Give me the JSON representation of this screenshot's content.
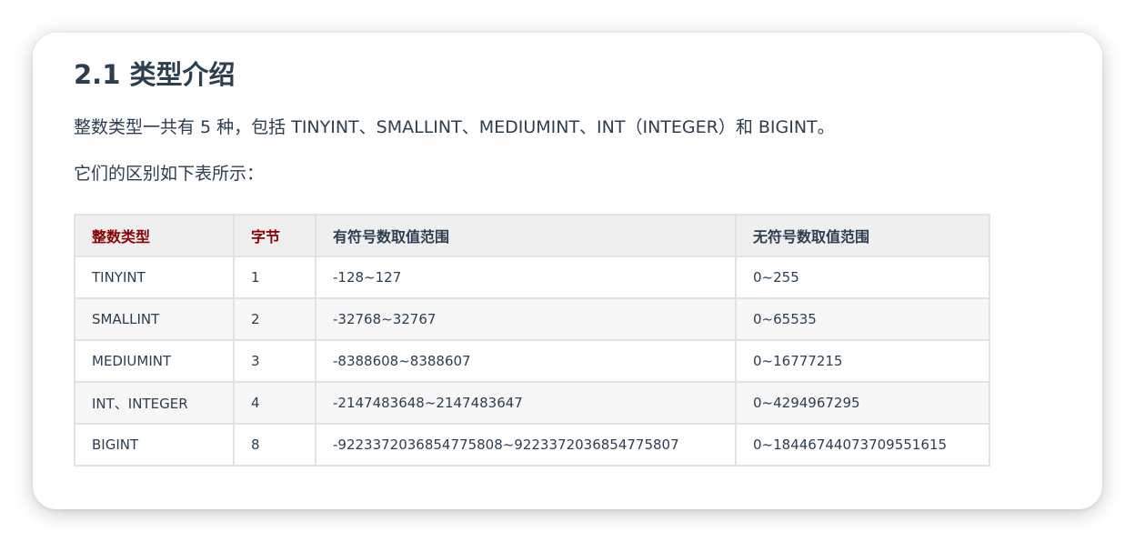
{
  "section": {
    "title": "2.1 类型介绍",
    "intro": "整数类型一共有 5 种，包括 TINYINT、SMALLINT、MEDIUMINT、INT（INTEGER）和 BIGINT。",
    "table_intro": "它们的区别如下表所示："
  },
  "table": {
    "headers": [
      "整数类型",
      "字节",
      "有符号数取值范围",
      "无符号数取值范围"
    ],
    "rows": [
      [
        "TINYINT",
        "1",
        "-128~127",
        "0~255"
      ],
      [
        "SMALLINT",
        "2",
        "-32768~32767",
        "0~65535"
      ],
      [
        "MEDIUMINT",
        "3",
        "-8388608~8388607",
        "0~16777215"
      ],
      [
        "INT、INTEGER",
        "4",
        "-2147483648~2147483647",
        "0~4294967295"
      ],
      [
        "BIGINT",
        "8",
        "-9223372036854775808~9223372036854775807",
        "0~18446744073709551615"
      ]
    ]
  },
  "colors": {
    "text": "#2c3e50",
    "header_highlight": "#8b0000",
    "header_bg": "#efefef",
    "border": "#e2e2e2"
  }
}
